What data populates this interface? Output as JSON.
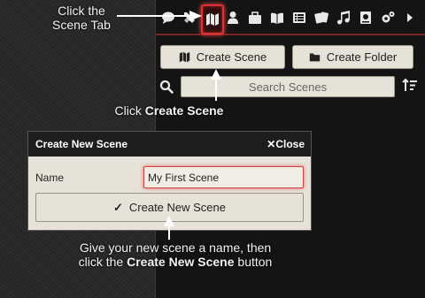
{
  "annotations": {
    "tab_hint_line1": "Click the",
    "tab_hint_line2": "Scene Tab",
    "create_hint_prefix": "Click ",
    "create_hint_bold": "Create Scene",
    "name_hint_line1": "Give your new scene a name, then",
    "name_hint_prefix": "click the ",
    "name_hint_bold": "Create New Scene",
    "name_hint_suffix": " button"
  },
  "sidebar": {
    "tabs": [
      "chat-icon",
      "combat-icon",
      "map-icon",
      "actors-icon",
      "items-icon",
      "journal-icon",
      "tables-icon",
      "cards-icon",
      "music-icon",
      "compendium-icon",
      "settings-icon",
      "expand-icon"
    ],
    "active_tab": "map-icon",
    "create_scene_label": "Create Scene",
    "create_folder_label": "Create Folder",
    "search_placeholder": "Search Scenes"
  },
  "dialog": {
    "title": "Create New Scene",
    "close_label": "Close",
    "name_label": "Name",
    "name_value": "My First Scene",
    "submit_label": "Create New Scene"
  },
  "colors": {
    "active_tab_glow": "#dd3333",
    "panel": "#141414",
    "button": "#e6e2d8"
  }
}
